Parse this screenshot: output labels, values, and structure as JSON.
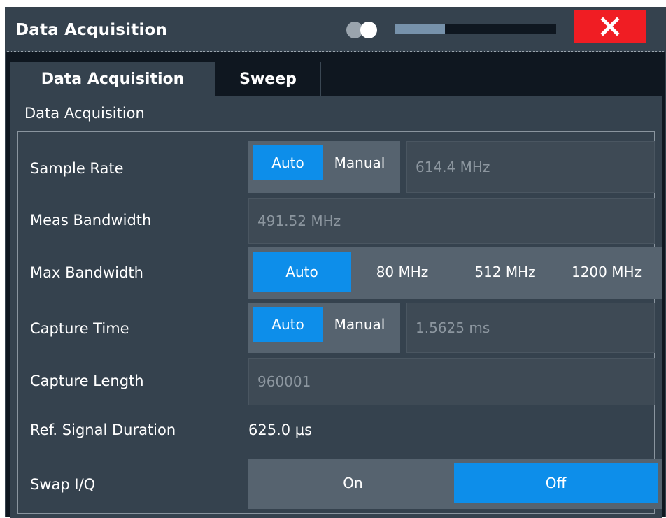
{
  "window": {
    "title": "Data Acquisition",
    "slider_fraction": 0.31
  },
  "tabs": [
    {
      "label": "Data Acquisition",
      "active": true
    },
    {
      "label": "Sweep",
      "active": false
    }
  ],
  "group": {
    "label": "Data Acquisition"
  },
  "rows": {
    "sample_rate": {
      "label": "Sample Rate",
      "options": [
        "Auto",
        "Manual"
      ],
      "selected": "Auto",
      "value": "614.4 MHz"
    },
    "meas_bandwidth": {
      "label": "Meas Bandwidth",
      "value": "491.52 MHz"
    },
    "max_bandwidth": {
      "label": "Max Bandwidth",
      "options": [
        "Auto",
        "80 MHz",
        "512 MHz",
        "1200 MHz"
      ],
      "selected": "Auto"
    },
    "capture_time": {
      "label": "Capture Time",
      "options": [
        "Auto",
        "Manual"
      ],
      "selected": "Auto",
      "value": "1.5625 ms"
    },
    "capture_length": {
      "label": "Capture Length",
      "value": "960001"
    },
    "ref_signal_duration": {
      "label": "Ref. Signal Duration",
      "value": "625.0 µs"
    },
    "swap_iq": {
      "label": "Swap I/Q",
      "options": [
        "On",
        "Off"
      ],
      "selected": "Off"
    }
  },
  "colors": {
    "accent": "#0d8eea",
    "close": "#f01d23",
    "panel": "#35424e",
    "background": "#0f1720"
  },
  "icons": {
    "toggle": "toggle-icon",
    "close": "close-icon"
  }
}
